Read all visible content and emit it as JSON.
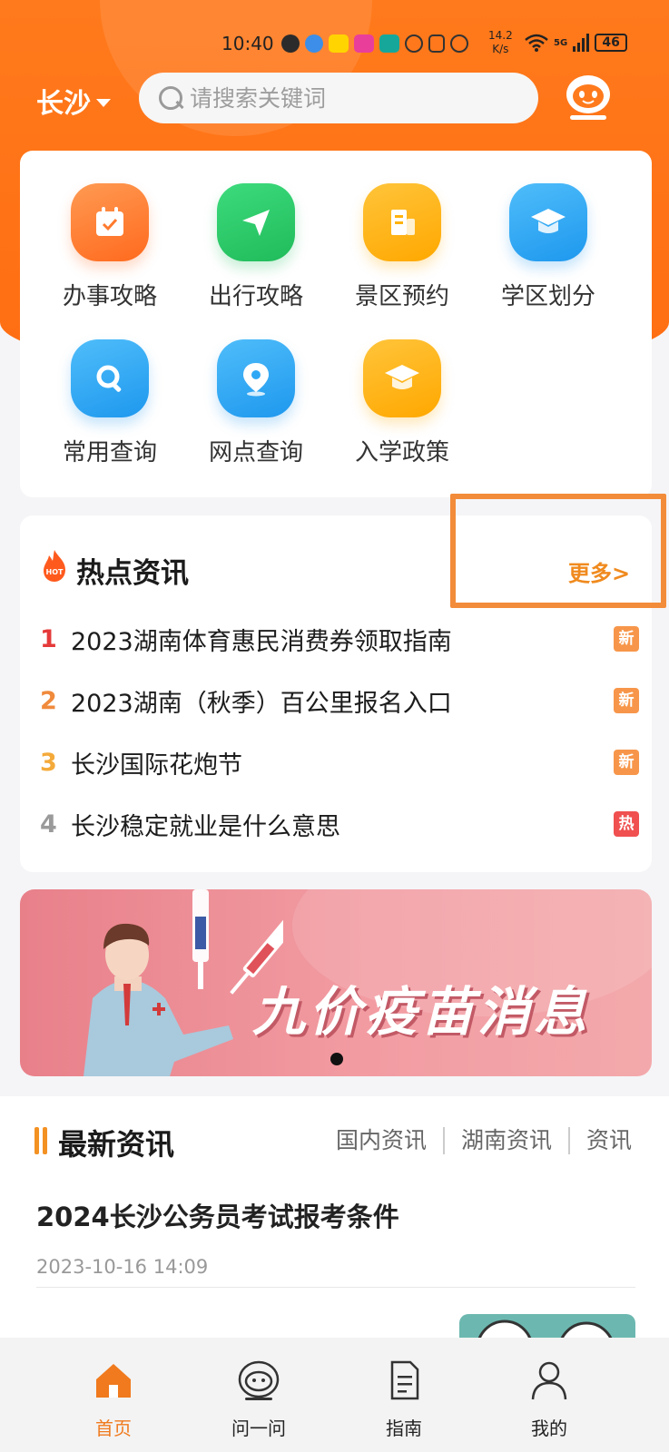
{
  "status_bar": {
    "time": "10:40",
    "speed_top": "14.2",
    "speed_bottom": "K/s",
    "network": "5G",
    "battery": "46"
  },
  "header": {
    "city": "长沙",
    "search_placeholder": "请搜索关键词"
  },
  "quick_grid": [
    {
      "label": "办事攻略",
      "icon": "calendar-check-icon",
      "color": "#ff7a2e"
    },
    {
      "label": "出行攻略",
      "icon": "send-plane-icon",
      "color": "#2dcc6b"
    },
    {
      "label": "景区预约",
      "icon": "building-icon",
      "color": "#ffb30f"
    },
    {
      "label": "学区划分",
      "icon": "graduation-cap-icon",
      "color": "#2ea8f5"
    },
    {
      "label": "常用查询",
      "icon": "magnifier-icon",
      "color": "#2ea8f5"
    },
    {
      "label": "网点查询",
      "icon": "location-pin-icon",
      "color": "#2ea8f5"
    },
    {
      "label": "入学政策",
      "icon": "graduation-cap-icon",
      "color": "#ffb30f"
    }
  ],
  "hot_news": {
    "title": "热点资讯",
    "fire_badge": "HOT",
    "more": "更多>",
    "items": [
      {
        "rank": "1",
        "text": "2023湖南体育惠民消费券领取指南",
        "badge": "新",
        "rank_color": "#e53a3a",
        "badge_color": "#f7964a"
      },
      {
        "rank": "2",
        "text": "2023湖南（秋季）百公里报名入口",
        "badge": "新",
        "rank_color": "#f08a3c",
        "badge_color": "#f7964a"
      },
      {
        "rank": "3",
        "text": "长沙国际花炮节",
        "badge": "新",
        "rank_color": "#f4aa3a",
        "badge_color": "#f7964a"
      },
      {
        "rank": "4",
        "text": "长沙稳定就业是什么意思",
        "badge": "热",
        "rank_color": "#9a9a9a",
        "badge_color": "#f05050"
      }
    ]
  },
  "banner": {
    "text": "九价疫苗消息"
  },
  "latest_news": {
    "title": "最新资讯",
    "tabs": [
      "国内资讯",
      "湖南资讯",
      "资讯"
    ],
    "article": {
      "title": "2024长沙公务员考试报考条件",
      "date": "2023-10-16 14:09"
    }
  },
  "bottom_nav": [
    {
      "label": "首页",
      "icon": "home-icon",
      "active": true
    },
    {
      "label": "问一问",
      "icon": "robot-face-icon",
      "active": false
    },
    {
      "label": "指南",
      "icon": "document-icon",
      "active": false
    },
    {
      "label": "我的",
      "icon": "user-icon",
      "active": false
    }
  ]
}
